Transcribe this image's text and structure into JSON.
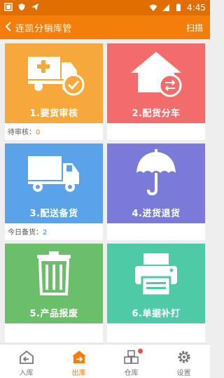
{
  "status_bar": {
    "time": "4:45"
  },
  "header": {
    "back_icon": "chevron-left-icon",
    "title": "连凯分销库管",
    "scan_label": "扫描"
  },
  "tiles": [
    {
      "label": "1.要货审核",
      "color": "#f7a83a",
      "icon": "truck-check-icon",
      "info_label": "待审核：",
      "info_value": "0"
    },
    {
      "label": "2.配货分车",
      "color": "#f26c6c",
      "icon": "house-swap-icon"
    },
    {
      "label": "3.配送备货",
      "color": "#5aa3e8",
      "icon": "delivery-truck-icon",
      "info_label": "今日备货：",
      "info_value": "2"
    },
    {
      "label": "4.进货退货",
      "color": "#7a7ad8",
      "icon": "umbrella-icon"
    },
    {
      "label": "5.产品报废",
      "color": "#6cbf6a",
      "icon": "trash-icon"
    },
    {
      "label": "6.单据补打",
      "color": "#4ecba6",
      "icon": "printer-icon"
    }
  ],
  "tabbar": {
    "items": [
      {
        "label": "入库",
        "icon": "inbound-icon",
        "active": false
      },
      {
        "label": "出库",
        "icon": "outbound-house-icon",
        "active": true
      },
      {
        "label": "仓库",
        "icon": "warehouse-boxes-icon",
        "active": false,
        "badge": true
      },
      {
        "label": "设置",
        "icon": "gear-icon",
        "active": false
      }
    ],
    "active_color": "#f57d0c"
  }
}
